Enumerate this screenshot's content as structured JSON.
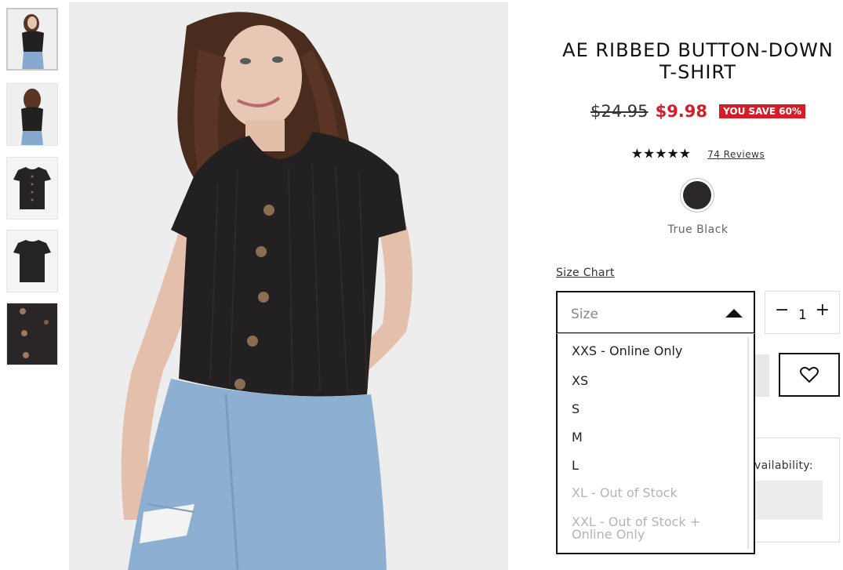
{
  "product": {
    "title_line1": "AE RIBBED BUTTON-DOWN",
    "title_line2": "T-SHIRT",
    "original_price": "$24.95",
    "sale_price": "$9.98",
    "savings_badge": "YOU SAVE 60%",
    "rating_stars": "★★★★★",
    "reviews_link": "74 Reviews",
    "color_name": "True Black",
    "swatch_color": "#2b2628"
  },
  "gallery": {
    "thumbnails": [
      "model-front",
      "model-back",
      "flat-front",
      "flat-back",
      "fabric-detail"
    ],
    "selected_index": 0
  },
  "size": {
    "size_chart_link": "Size Chart",
    "placeholder": "Size",
    "options": [
      {
        "label": "XXS - Online Only",
        "available": true
      },
      {
        "label": "XS",
        "available": true
      },
      {
        "label": "S",
        "available": true
      },
      {
        "label": "M",
        "available": true
      },
      {
        "label": "L",
        "available": true
      },
      {
        "label": "XL - Out of Stock",
        "available": false
      },
      {
        "label": "XXL - Out of Stock + Online Only",
        "available": false
      }
    ]
  },
  "quantity": {
    "minus": "−",
    "value": "1",
    "plus": "+"
  },
  "store": {
    "availability_text": "vailability:"
  },
  "colors": {
    "sale_red": "#d51c29",
    "border_dark": "#111111"
  }
}
